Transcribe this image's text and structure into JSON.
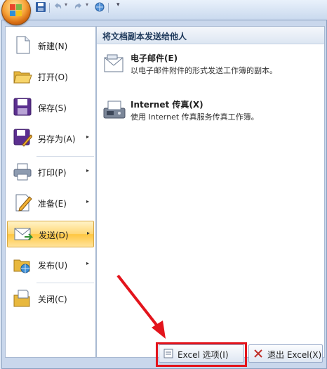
{
  "menu_items": [
    {
      "label": "新建(N)",
      "icon": "new-document-icon",
      "has_submenu": false
    },
    {
      "label": "打开(O)",
      "icon": "open-folder-icon",
      "has_submenu": false
    },
    {
      "label": "保存(S)",
      "icon": "save-disk-icon",
      "has_submenu": false
    },
    {
      "label": "另存为(A)",
      "icon": "save-as-icon",
      "has_submenu": true
    },
    {
      "label": "打印(P)",
      "icon": "printer-icon",
      "has_submenu": true
    },
    {
      "label": "准备(E)",
      "icon": "prepare-pencil-icon",
      "has_submenu": true
    },
    {
      "label": "发送(D)",
      "icon": "send-mail-icon",
      "has_submenu": true,
      "active": true
    },
    {
      "label": "发布(U)",
      "icon": "publish-folder-icon",
      "has_submenu": true
    },
    {
      "label": "关闭(C)",
      "icon": "close-folder-icon",
      "has_submenu": false
    }
  ],
  "submenu": {
    "header": "将文档副本发送给他人",
    "items": [
      {
        "title": "电子邮件(E)",
        "description": "以电子邮件附件的形式发送工作簿的副本。",
        "icon": "email-icon"
      },
      {
        "title": "Internet 传真(X)",
        "description": "使用 Internet 传真服务传真工作簿。",
        "icon": "fax-icon"
      }
    ]
  },
  "bottom": {
    "options_label": "Excel 选项(I)",
    "exit_label": "退出 Excel(X)"
  },
  "arrow_symbol": "▸",
  "colors": {
    "accent_highlight": "#ffd774",
    "annotation_red": "#e3141c",
    "header_text": "#1e395b"
  }
}
